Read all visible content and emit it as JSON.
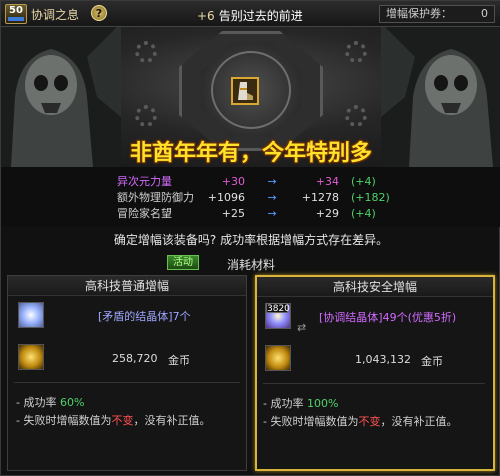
{
  "header": {
    "level": "50",
    "skill_name": "协调之息",
    "help_label": "?",
    "enhance_prefix": "+6",
    "enhance_title": "告别过去的前进",
    "protect_label": "增幅保护券：",
    "protect_value": "0"
  },
  "banner": "非酋年年有，今年特别多",
  "stats": [
    {
      "label": "异次元力量",
      "before": "+30",
      "arrow": "→",
      "after": "+34",
      "delta": "(+4)"
    },
    {
      "label": "额外物理防御力",
      "before": "+1096",
      "arrow": "→",
      "after": "+1278",
      "delta": "(+182)"
    },
    {
      "label": "冒险家名望",
      "before": "+25",
      "arrow": "→",
      "after": "+29",
      "delta": "(+4)"
    }
  ],
  "confirm_text": "确定增幅该装备吗? 成功率根据增幅方式存在差异。",
  "tabs": {
    "active_label": "活动",
    "materials_label": "消耗材料"
  },
  "panels": {
    "normal": {
      "title": "高科技普通增幅",
      "material": "[矛盾的结晶体]7个",
      "gold_amount": "258,720",
      "gold_unit": "金币",
      "success_label": "成功率",
      "success_rate": "60%",
      "fail_prefix": "失败时增幅数值为",
      "fail_keyword": "不变",
      "fail_suffix": "，没有补正值。",
      "bullet": "-"
    },
    "safe": {
      "title": "高科技安全增幅",
      "material_count_badge": "3820",
      "material": "[协调结晶体]49个(优惠5折)",
      "gold_amount": "1,043,132",
      "gold_unit": "金币",
      "success_label": "成功率",
      "success_rate": "100%",
      "fail_prefix": "失败时增幅数值为",
      "fail_keyword": "不变",
      "fail_suffix": "，没有补正值。",
      "bullet": "-"
    }
  },
  "icons": {
    "swap": "swap-icon",
    "arrow": "arrow-right-icon"
  },
  "colors": {
    "accent_gold": "#d8b43a",
    "banner_yellow": "#ffe22a",
    "success_green": "#4fd26a",
    "fail_red": "#ff5050",
    "material_purple": "#d26bff",
    "material_blue": "#9fa6ff"
  }
}
